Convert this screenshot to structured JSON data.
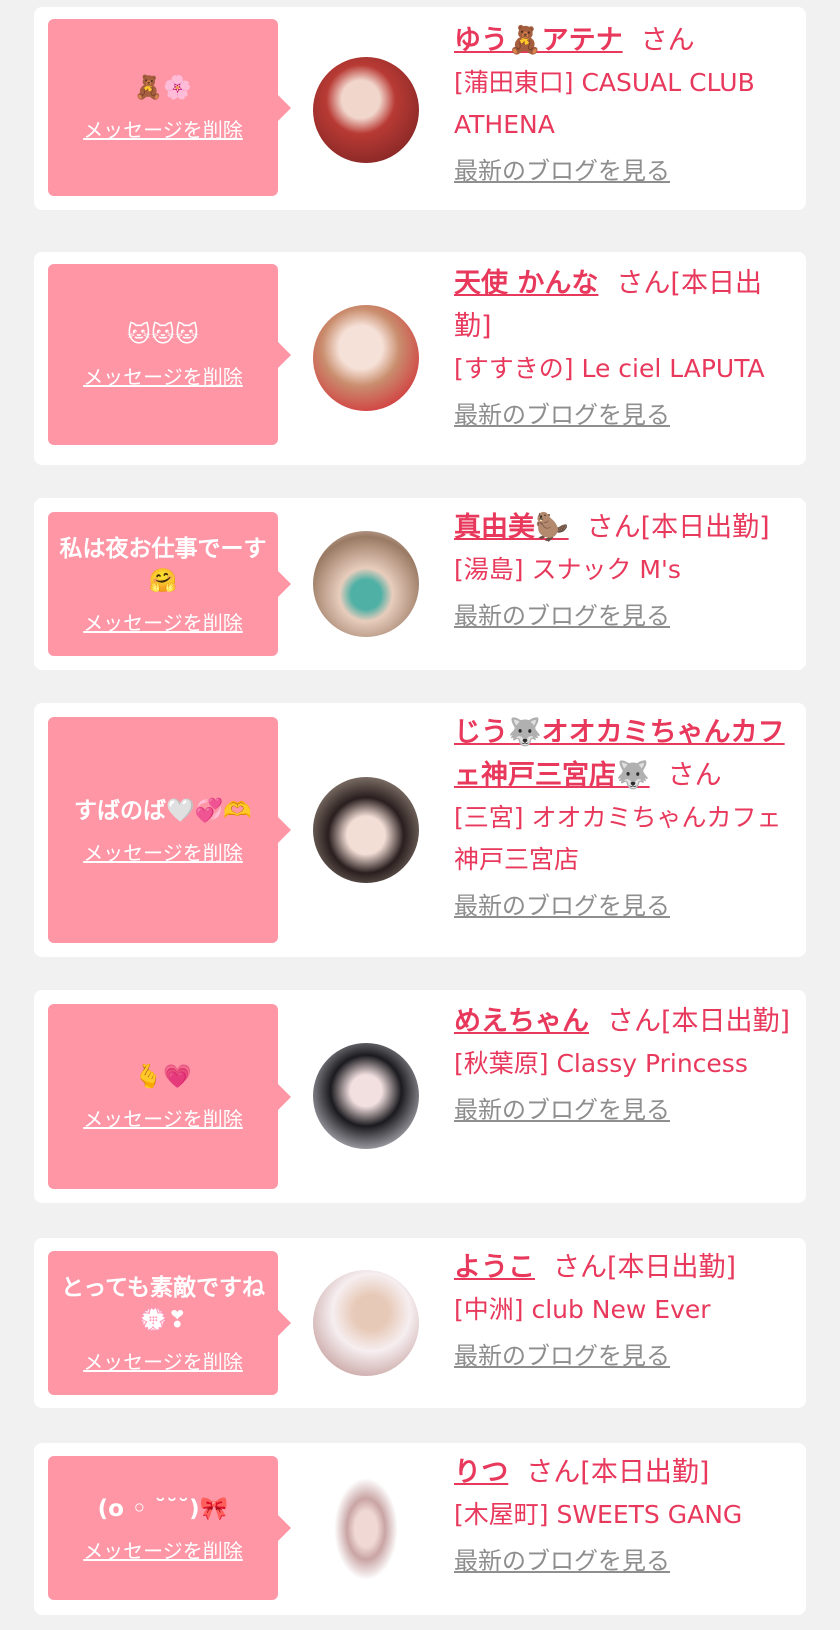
{
  "delete_label": "メッセージを削除",
  "san_label": "さん",
  "blog_label": "最新のブログを見る",
  "colors": {
    "background": "#f1f1f1",
    "card": "#ffffff",
    "bubble": "#fe96a6",
    "accent": "#e8395c",
    "link_gray": "#8e8e8e"
  },
  "items": [
    {
      "message": "🧸🌸",
      "name": "ゆう🧸アテナ",
      "status": "",
      "shop": "[蒲田東口] CASUAL CLUB ATHENA"
    },
    {
      "message": "🐱🐱🐱",
      "name": "天使 かんな",
      "status": "[本日出勤]",
      "shop": "[すすきの] Le ciel LAPUTA"
    },
    {
      "message": "私は夜お仕事でーす🤗",
      "name": "真由美🦫",
      "status": "[本日出勤]",
      "shop": "[湯島] スナック M's"
    },
    {
      "message": "すばのば🤍💞🫶",
      "name": "じう🐺オオカミちゃんカフェ神戸三宮店🐺",
      "status": "",
      "shop": "[三宮] オオカミちゃんカフェ神戸三宮店"
    },
    {
      "message": "🫰💗",
      "name": "めえちゃん",
      "status": "[本日出勤]",
      "shop": "[秋葉原] Classy Princess"
    },
    {
      "message": "とっても素敵ですね💮❣",
      "name": "ようこ",
      "status": "[本日出勤]",
      "shop": "[中洲] club New Ever"
    },
    {
      "message": "(o ◦ ˘˘˘)🎀",
      "name": "りつ",
      "status": "[本日出勤]",
      "shop": "[木屋町] SWEETS GANG"
    }
  ]
}
